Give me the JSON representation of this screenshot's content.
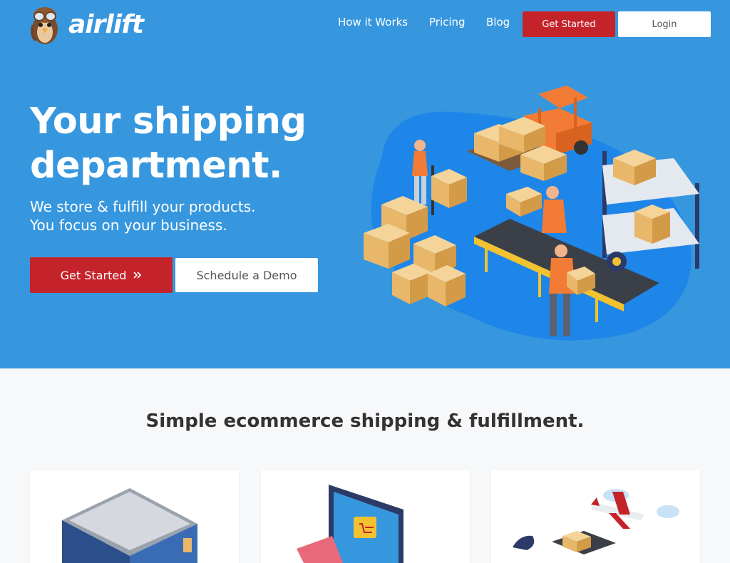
{
  "brand": {
    "name": "airlift",
    "logo_icon": "pilot-bird-icon"
  },
  "nav": {
    "links": [
      "How it Works",
      "Pricing",
      "Blog"
    ],
    "get_started": "Get Started",
    "login": "Login"
  },
  "hero": {
    "title_line1": "Your shipping",
    "title_line2": "department.",
    "subtitle_line1": "We store & fulfill your products.",
    "subtitle_line2": "You focus on your business.",
    "cta_primary": "Get Started",
    "cta_primary_icon": "double-chevron-right-icon",
    "cta_secondary": "Schedule a Demo",
    "illustration": "warehouse-isometric-illustration"
  },
  "features": {
    "title": "Simple ecommerce shipping & fulfillment.",
    "cards": [
      {
        "illustration": "warehouse-box-illustration"
      },
      {
        "illustration": "online-store-monitor-illustration"
      },
      {
        "illustration": "shipping-plane-illustration"
      }
    ]
  },
  "colors": {
    "hero_bg": "#3797de",
    "accent_red": "#c5232a",
    "section_bg": "#f7f8fa",
    "box_tan": "#e8b76a"
  }
}
